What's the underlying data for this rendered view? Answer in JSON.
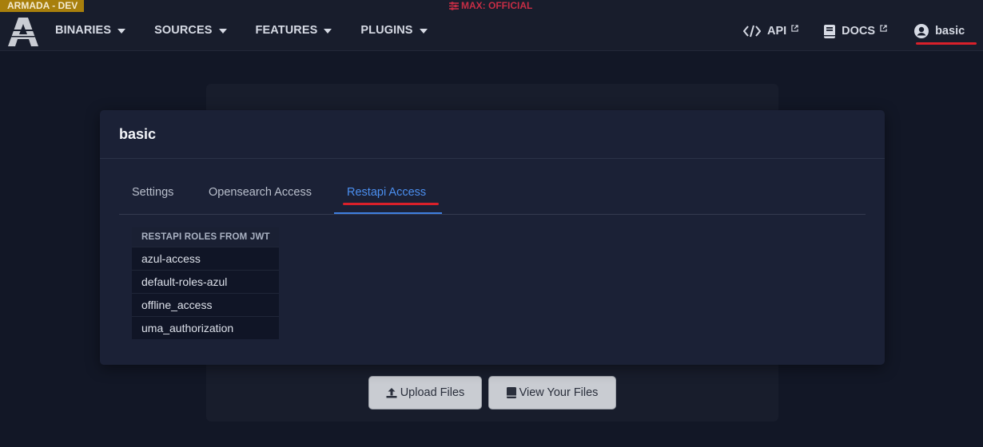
{
  "env_badge": "ARMADA - DEV",
  "classification": "MAX: OFFICIAL",
  "nav": {
    "left": [
      {
        "label": "BINARIES"
      },
      {
        "label": "SOURCES"
      },
      {
        "label": "FEATURES"
      },
      {
        "label": "PLUGINS"
      }
    ],
    "api_label": "API",
    "docs_label": "DOCS",
    "user_label": "basic"
  },
  "buttons": {
    "upload": "Upload Files",
    "view": "View Your Files"
  },
  "modal": {
    "title": "basic",
    "tabs": [
      "Settings",
      "Opensearch Access",
      "Restapi Access"
    ],
    "active_tab": "Restapi Access",
    "table_header": "RESTAPI ROLES FROM JWT",
    "roles": [
      "azul-access",
      "default-roles-azul",
      "offline_access",
      "uma_authorization"
    ]
  },
  "colors": {
    "accent": "#3f7fe0",
    "highlight_red": "#d9202a",
    "badge": "#a87f0c",
    "classification": "#c62d45"
  },
  "icons": {
    "logo": "armada-logo",
    "caret": "caret-down-icon",
    "api": "code-icon",
    "docs": "book-icon",
    "user": "user-circle-icon",
    "external": "external-link-icon",
    "upload": "upload-icon",
    "view": "book-icon"
  }
}
